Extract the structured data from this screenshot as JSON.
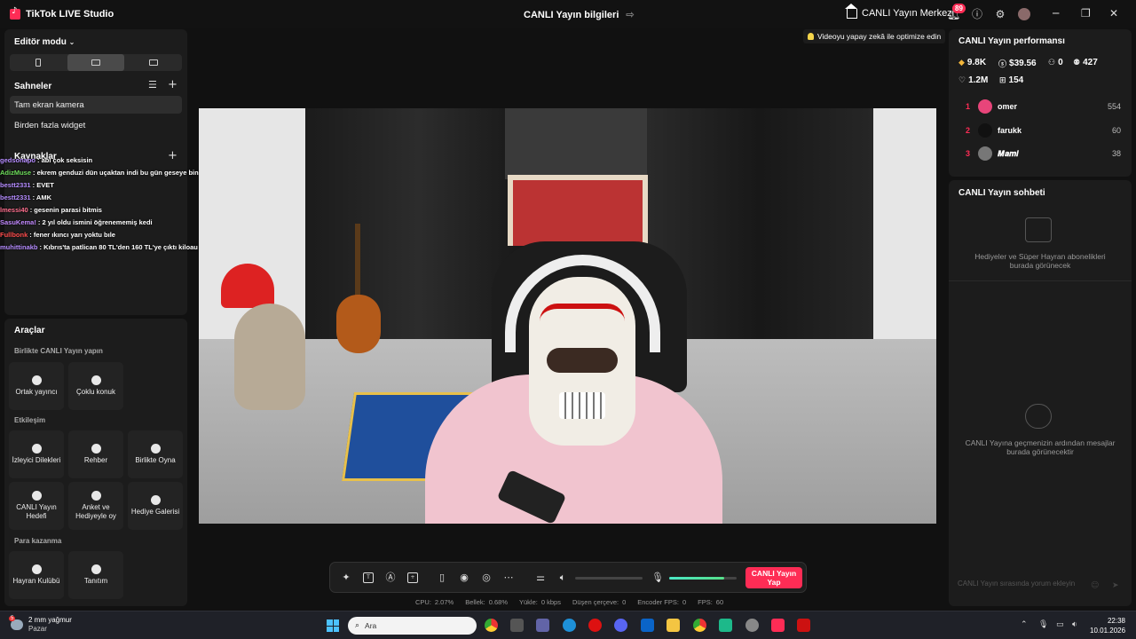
{
  "app": {
    "title": "TikTok LIVE Studio"
  },
  "header": {
    "live_info": "CANLI Yayın bilgileri",
    "live_center": "CANLI Yayın Merkezi",
    "notification_count": "89"
  },
  "left": {
    "editor_mode": "Editör modu",
    "scenes_title": "Sahneler",
    "scenes": [
      "Tam ekran kamera",
      "Birden fazla widget"
    ],
    "sources_title": "Kaynaklar"
  },
  "chat_overlay": [
    {
      "user": "gedsonapo",
      "text": ": abi çok seksisin",
      "color": "#b58cff"
    },
    {
      "user": "AdizMuse",
      "text": ": ekrem genduzi dün uçaktan indi bu gün geseye bindi",
      "color": "#6ddc5a"
    },
    {
      "user": "bestt2331",
      "text": ": EVET",
      "color": "#b58cff"
    },
    {
      "user": "bestt2331",
      "text": ": AMK",
      "color": "#b58cff"
    },
    {
      "user": "lmessi40",
      "text": ": gesenin parasi bitmis",
      "color": "#ff6f8e"
    },
    {
      "user": "SasuKema!",
      "text": ": 2 yıl oldu ismini öğrenememiş kedi",
      "color": "#c289ff"
    },
    {
      "user": "Fullbonk",
      "text": ": fener ıkıncı yarı yoktu bıle",
      "color": "#ff4d4d"
    },
    {
      "user": "muhittinakb",
      "text": ": Kıbrıs'ta patlican 80 TL'den 160 TL'ye çıktı kiloau",
      "color": "#b58cff"
    }
  ],
  "tools": {
    "title": "Araçlar",
    "groups": [
      {
        "title": "Birlikte CANLI Yayın yapın",
        "items": [
          "Ortak yayıncı",
          "Çoklu konuk"
        ]
      },
      {
        "title": "Etkileşim",
        "items": [
          "İzleyici Dilekleri",
          "Rehber",
          "Birlikte Oyna",
          "CANLI Yayın Hedefi",
          "Anket ve Hediyeyle oy",
          "Hediye Galerisi"
        ]
      },
      {
        "title": "Para kazanma",
        "items": [
          "Hayran Kulübü",
          "Tanıtım"
        ]
      }
    ]
  },
  "video": {
    "optimize_label": "Videoyu yapay zekâ ile optimize edin"
  },
  "toolbar": {
    "go_live": "CANLI Yayın Yap",
    "mic_level": 0.82
  },
  "stats": [
    {
      "label": "CPU:",
      "value": "2.07%"
    },
    {
      "label": "Bellek:",
      "value": "0.68%"
    },
    {
      "label": "Yükle:",
      "value": "0 kbps"
    },
    {
      "label": "Düşen çerçeve:",
      "value": "0"
    },
    {
      "label": "Encoder FPS:",
      "value": "0"
    },
    {
      "label": "FPS:",
      "value": "60"
    }
  ],
  "right": {
    "perf_title": "CANLI Yayın performansı",
    "metrics": {
      "diamonds": "9.8K",
      "earnings": "$39.56",
      "viewers": "0",
      "followers": "427",
      "likes": "1.2M",
      "gifts": "154"
    },
    "ranking": [
      {
        "rank": "1",
        "name": "omer",
        "score": "554"
      },
      {
        "rank": "2",
        "name": "farukk",
        "score": "60"
      },
      {
        "rank": "3",
        "name": "𝑴𝒂𝒎𝒊",
        "score": "38"
      }
    ],
    "chat_title": "CANLI Yayın sohbeti",
    "gifts_empty": "Hediyeler ve Süper Hayran abonelikleri burada görünecek",
    "messages_empty": "CANLI Yayına geçmenizin ardından mesajlar burada görünecektir",
    "comment_placeholder": "CANLI Yayın sırasında yorum ekleyin"
  },
  "taskbar": {
    "weather_temp": "2 mm yağmur",
    "weather_day": "Pazar",
    "weather_badge": "5",
    "search_placeholder": "Ara",
    "time": "22:38",
    "date": "10.01.2026"
  }
}
